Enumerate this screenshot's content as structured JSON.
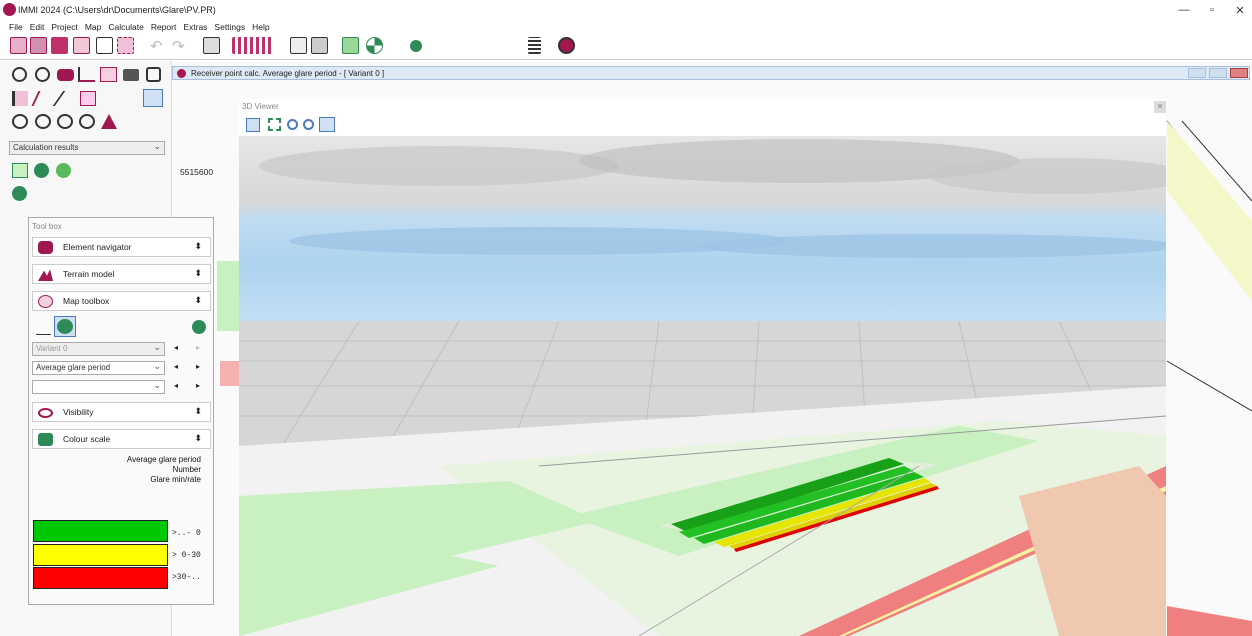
{
  "window": {
    "title": "IMMI 2024 (C:\\Users\\dr\\Documents\\Glare\\PV.PR)",
    "min_label": "—",
    "max_label": "▫",
    "close_label": "✕"
  },
  "menu": [
    "File",
    "Edit",
    "Project",
    "Map",
    "Calculate",
    "Report",
    "Extras",
    "Settings",
    "Help"
  ],
  "left_panel": {
    "results_select": "Calculation results",
    "coord_label": "5515600"
  },
  "toolbox": {
    "title": "Tool box",
    "sections": {
      "element_navigator": "Element navigator",
      "terrain_model": "Terrain model",
      "map_toolbox": "Map toolbox",
      "visibility": "Visibility",
      "colour_scale": "Colour scale"
    },
    "variant_select": "Variant 0",
    "metric_select": "Average glare period",
    "third_select": "",
    "legend": {
      "title": "Average glare period",
      "number_label": "Number",
      "unit_label": "Glare min/rate",
      "items": [
        {
          "color": "#00c800",
          "label": ">..- 0"
        },
        {
          "color": "#ffff00",
          "label": "> 0-30"
        },
        {
          "color": "#ff0000",
          "label": ">30-.."
        }
      ]
    }
  },
  "subwindow": {
    "title": "Receiver point calc. Average glare period - [ Variant 0 ]"
  },
  "viewer": {
    "title": "3D Viewer",
    "close_label": "✕"
  },
  "colors": {
    "accent": "#2e8b57",
    "titlebar_bg": "#dfe9f5",
    "sky": "#a9d0f0",
    "grass": "#c8f0c0",
    "road": "#f08080"
  }
}
